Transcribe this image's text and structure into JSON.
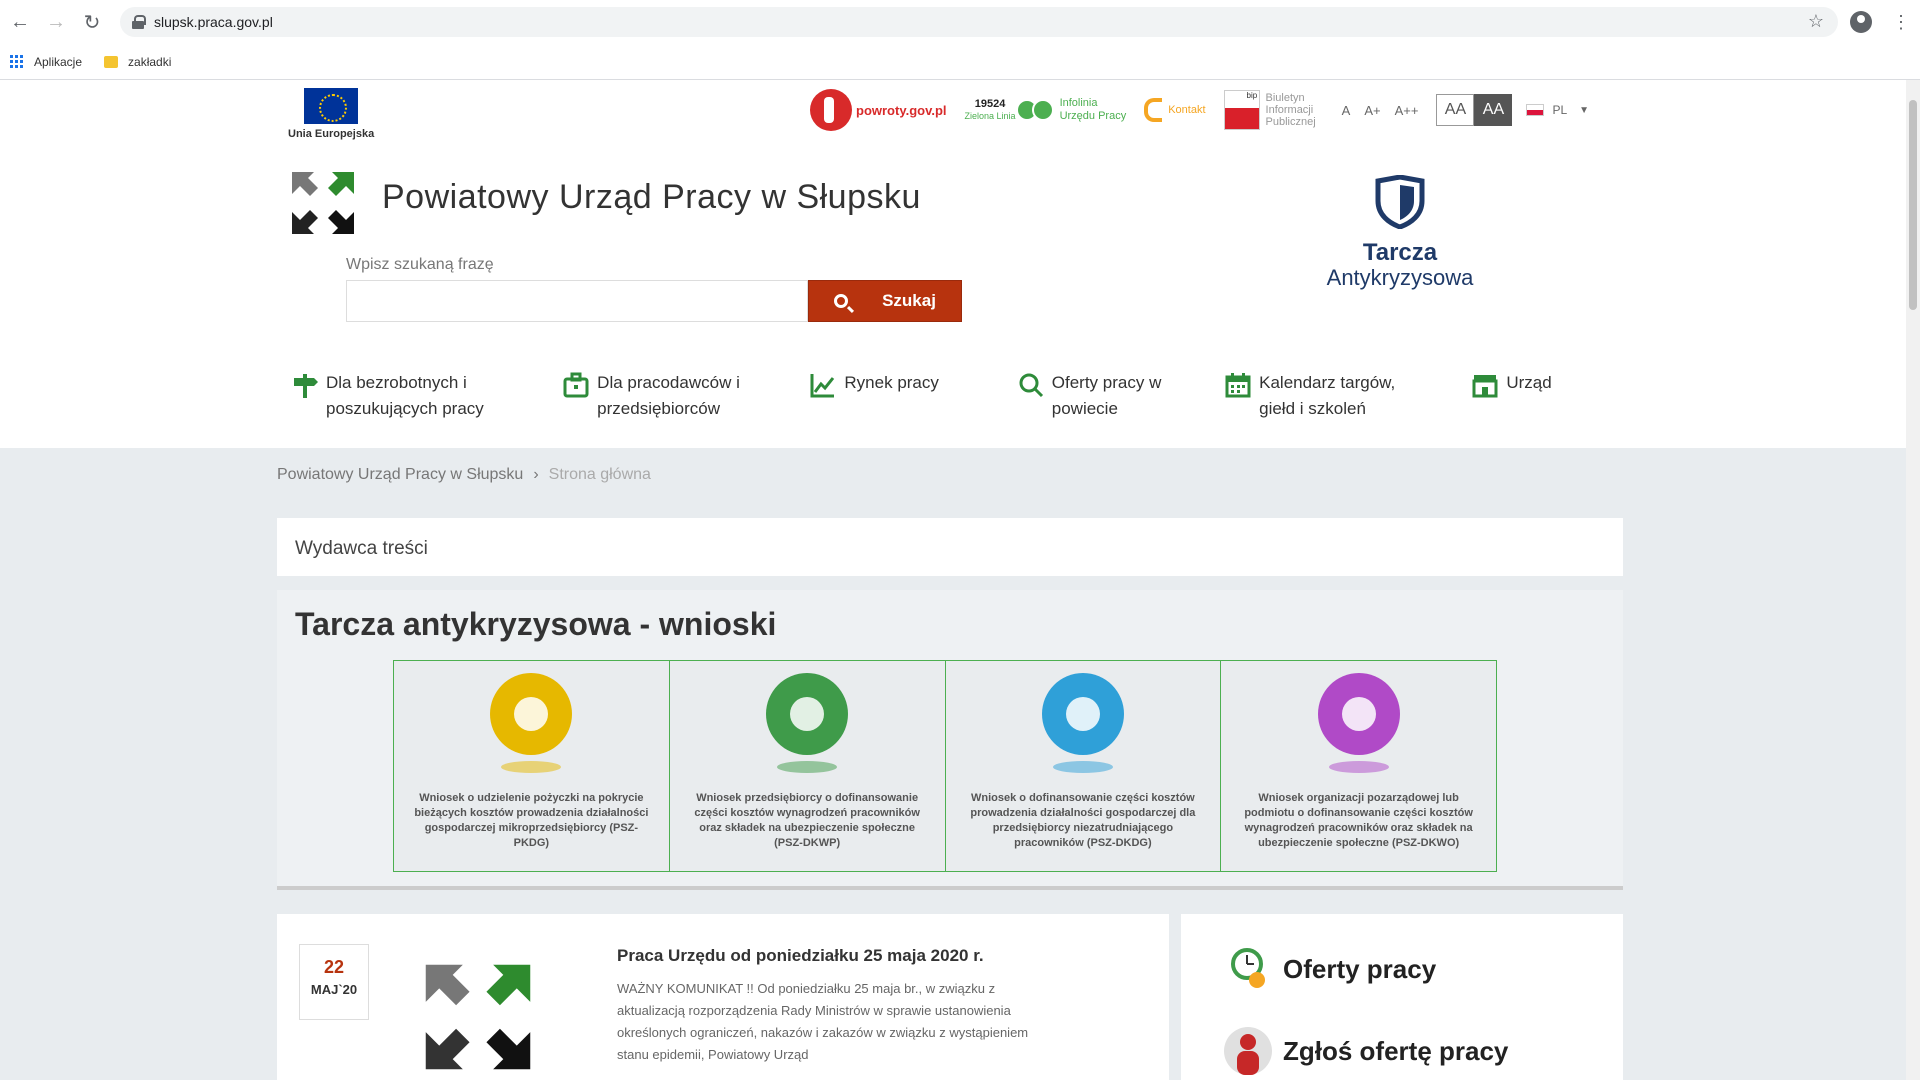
{
  "browser": {
    "url": "slupsk.praca.gov.pl",
    "bookmarks": [
      "Aplikacje",
      "zakładki"
    ]
  },
  "header": {
    "eu_label": "Unia Europejska",
    "powroty": "powroty.gov.pl",
    "infolinia_number": "19524",
    "infolinia_sub": "Zielona Linia",
    "infolinia_text1": "Infolinia",
    "infolinia_text2": "Urzędu Pracy",
    "kontakt": "Kontakt",
    "bip_line1": "Biuletyn",
    "bip_line2": "Informacji",
    "bip_line3": "Publicznej",
    "bip_badge": "bip",
    "font_sizes": [
      "A",
      "A+",
      "A++"
    ],
    "contrast": [
      "AA",
      "AA"
    ],
    "lang": "PL",
    "site_title": "Powiatowy Urząd Pracy w Słupsku",
    "tarcza_t1": "Tarcza",
    "tarcza_t2": "Antykryzysowa"
  },
  "search": {
    "label": "Wpisz szukaną frazę",
    "value": "",
    "button": "Szukaj"
  },
  "nav": [
    {
      "label": "Dla bezrobotnych i poszukujących pracy",
      "icon": "signpost-icon"
    },
    {
      "label": "Dla pracodawców i przedsiębiorców",
      "icon": "briefcase-icon"
    },
    {
      "label": "Rynek pracy",
      "icon": "chart-icon"
    },
    {
      "label": "Oferty pracy w powiecie",
      "icon": "search-icon"
    },
    {
      "label": "Kalendarz targów, giełd i szkoleń",
      "icon": "calendar-icon"
    },
    {
      "label": "Urząd",
      "icon": "building-icon"
    }
  ],
  "breadcrumb": {
    "home": "Powiatowy Urząd Pracy w Słupsku",
    "separator": "›",
    "current": "Strona główna"
  },
  "wydawca": "Wydawca treści",
  "tarcza_section": {
    "title": "Tarcza antykryzysowa - wnioski",
    "cards": [
      {
        "text": "Wniosek o udzielenie pożyczki na pokrycie bieżących kosztów prowadzenia działalności gospodarczej mikroprzedsiębiorcy (PSZ-PKDG)",
        "color": "#e6b800"
      },
      {
        "text": "Wniosek przedsiębiorcy o dofinansowanie części kosztów wynagrodzeń pracowników oraz składek na ubezpieczenie społeczne (PSZ-DKWP)",
        "color": "#3f9b4a"
      },
      {
        "text": "Wniosek o dofinansowanie części kosztów prowadzenia działalności gospodarczej dla przedsiębiorcy niezatrudniającego pracowników (PSZ-DKDG)",
        "color": "#2fa0d8"
      },
      {
        "text": "Wniosek organizacji pozarządowej lub podmiotu o dofinansowanie części kosztów wynagrodzeń pracowników oraz składek na ubezpieczenie społeczne (PSZ-DKWO)",
        "color": "#b04ac7"
      }
    ]
  },
  "news": {
    "day": "22",
    "month": "MAJ`20",
    "title": "Praca Urzędu od poniedziałku 25 maja 2020 r.",
    "text": "WAŻNY KOMUNIKAT !! Od poniedziałku 25 maja br., w związku z aktualizacją rozporządzenia Rady Ministrów w sprawie ustanowienia określonych ograniczeń, nakazów i zakazów w związku z wystąpieniem stanu epidemii, Powiatowy Urząd"
  },
  "side": {
    "item1": "Oferty pracy",
    "item2": "Zgłoś ofertę pracy"
  }
}
